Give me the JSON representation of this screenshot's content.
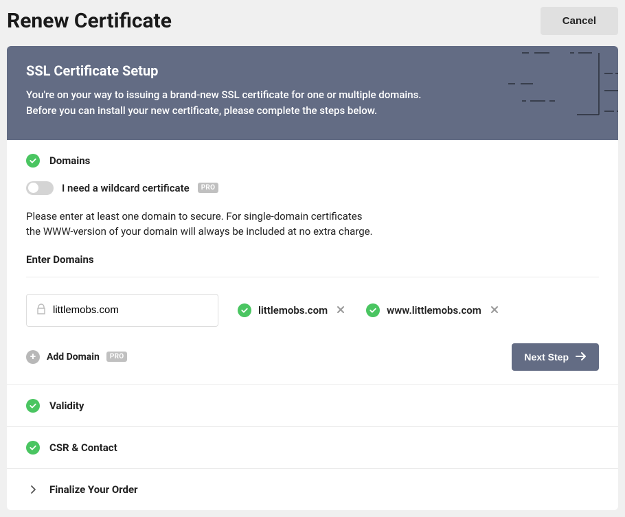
{
  "header": {
    "title": "Renew Certificate",
    "cancel": "Cancel"
  },
  "hero": {
    "title": "SSL Certificate Setup",
    "line1": "You're on your way to issuing a brand-new SSL certificate for one or multiple domains.",
    "line2": "Before you can install your new certificate, please complete the steps below."
  },
  "steps": {
    "domains": {
      "title": "Domains",
      "wildcard_label": "I need a wildcard certificate",
      "pro_badge": "PRO",
      "help_line1": "Please enter at least one domain to secure. For single-domain certificates",
      "help_line2": "the WWW-version of your domain will always be included at no extra charge.",
      "enter_label": "Enter Domains",
      "input_value": "littlemobs.com",
      "chips": [
        {
          "label": "littlemobs.com"
        },
        {
          "label": "www.littlemobs.com"
        }
      ],
      "add_domain": "Add Domain",
      "next": "Next Step"
    },
    "validity": {
      "title": "Validity"
    },
    "csr": {
      "title": "CSR & Contact"
    },
    "finalize": {
      "title": "Finalize Your Order"
    }
  }
}
